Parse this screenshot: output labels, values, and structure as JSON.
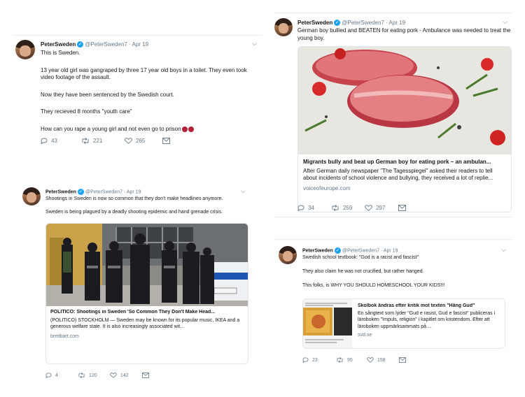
{
  "tweets": [
    {
      "name": "PeterSweden",
      "handle": "@PeterSweden7",
      "date": "· Apr 19",
      "lines": [
        "This is Sweden.",
        "13 year old girl was gangraped by three 17 year old boys in a toilet. They even took video footage of the assault.",
        "Now they have been sentenced by the Swedish court.",
        "They recieved 8 months \"youth care\"",
        "How can you rape a young girl and not even go to prison"
      ],
      "actions": {
        "replies": "43",
        "retweets": "221",
        "likes": "265"
      }
    },
    {
      "name": "PeterSweden",
      "handle": "@PeterSweden7",
      "date": "· Apr 19",
      "lines": [
        "German boy bullied and BEATEN for eating pork - Ambulance was needed to treat the young boy."
      ],
      "card": {
        "image_label": "raw pork chops on a board",
        "title": "Migrants bully and beat up German boy for eating pork – an ambulan...",
        "description": "After German daily newspaper \"The Tagesspiegel\" asked their readers to tell about incidents of school violence and bullying, they received a lot of replie...",
        "domain": "voiceofeurope.com"
      },
      "actions": {
        "replies": "34",
        "retweets": "259",
        "likes": "297"
      }
    },
    {
      "name": "PeterSweden",
      "handle": "@PeterSweden7",
      "date": "· Apr 19",
      "lines": [
        "Shootings in Sweden is now so common that they don't make headlines anymore.",
        "Sweden is being plagued by a deadly shooting epidemic and hand grenade crisis."
      ],
      "card": {
        "image_label": "armed police officers in Stockholm",
        "title": "POLITICO: Shootings in Sweden 'So Common They Don't Make Head...",
        "description": "(POLITICO) STOCKHOLM — Sweden may be known for its popular music, IKEA and a generous welfare state. It is also increasingly associated wit...",
        "domain": "breitbart.com"
      },
      "actions": {
        "replies": "4",
        "retweets": "120",
        "likes": "142"
      }
    },
    {
      "name": "PeterSweden",
      "handle": "@PeterSweden7",
      "date": "· Apr 19",
      "lines": [
        "Swedish school textbook: \"God is a racist and fascist\"",
        "They also claim he was not crucified, but rather hanged.",
        "This folks, is WHY YOU SHOULD HOMESCHOOL YOUR KIDS!!!"
      ],
      "card": {
        "image_label": "textbook page thumbnail",
        "title": "Skolbok ändras efter kritik mot texten \"Häng Gud\"",
        "description": "En sångtext som lyder \"Gud e rasist, Gud e fascist\" publiceras i läroboken \"Impuls, religion\" i kapitlet om kristendom. Efter att läroboken uppmärksammats på ...",
        "domain": "svd.se"
      },
      "actions": {
        "replies": "23",
        "retweets": "95",
        "likes": "158"
      }
    }
  ]
}
